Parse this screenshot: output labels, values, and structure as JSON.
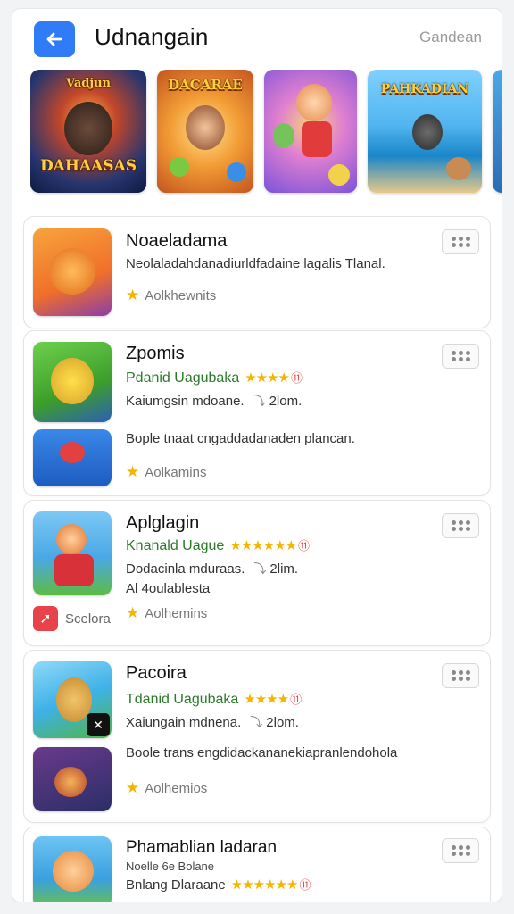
{
  "header": {
    "title": "Udnangain",
    "action_label": "Gandean"
  },
  "banners": [
    {
      "caption_top": "Vadjun",
      "caption_bottom": "DAHAASAS"
    },
    {
      "caption_top": "DACARAE",
      "caption_bottom": ""
    },
    {
      "caption_top": "",
      "caption_bottom": ""
    },
    {
      "caption_top": "PAHKADIAN",
      "caption_bottom": ""
    },
    {
      "caption_top": "",
      "caption_bottom": ""
    }
  ],
  "apps": [
    {
      "name": "Noaeladama",
      "description": "Neolaladahdanadiurldfadaine lagalis Tlanal.",
      "rating_text": "Aolkhewnits"
    },
    {
      "name": "Zpomis",
      "developer": "Pdanid Uagubaka",
      "stars": "★★★★",
      "badge": "⑪",
      "meta_left": "Kaiumgsin mdoane.",
      "meta_right": "2lom.",
      "description": "Boplе tnaat cngaddadanaden plancan.",
      "rating_text": "Aolkamins"
    },
    {
      "name": "Aplglagin",
      "developer": "Knanald Uague",
      "stars": "★★★★★★",
      "badge": "⑪",
      "meta_left": "Dodacinla mduraas.",
      "meta_right": "2lim.",
      "description": "Al 4oulablesta",
      "mini_badge_label": "Scelora",
      "rating_text": "Aolhemins"
    },
    {
      "name": "Pacoira",
      "developer": "Tdanid Uagubaka",
      "stars": "★★★★",
      "badge": "⑪",
      "meta_left": "Xaiungain mdnena.",
      "meta_right": "2lom.",
      "description": "Boolе trans engdidackananekiapranlendohola",
      "rating_text": "Aolhemios"
    },
    {
      "name": "Phamablian ladaran",
      "developer": "Noelle 6e Bolane",
      "meta_left": "Bnlang Dlaraane",
      "stars": "★★★★★★",
      "badge": "⑪"
    }
  ],
  "colors": {
    "accent": "#2f7cf6",
    "star": "#f5b400",
    "developer_green": "#2b7a2b"
  },
  "icons": [
    "back-arrow-icon",
    "more-dots-icon",
    "star-icon",
    "download-icon"
  ]
}
